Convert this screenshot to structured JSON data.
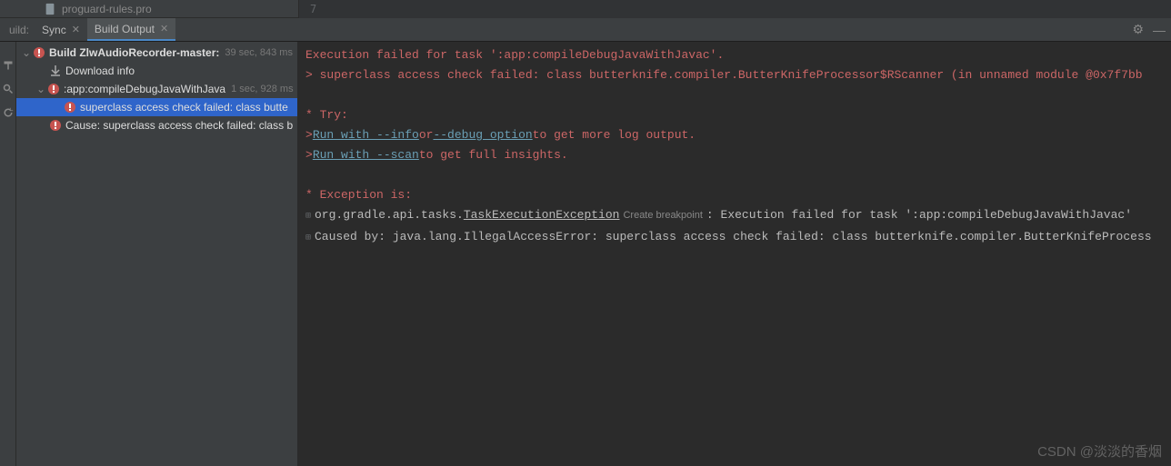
{
  "top_file": "proguard-rules.pro",
  "line_num": "7",
  "tabs": {
    "label": "uild:",
    "sync": "Sync",
    "build_output": "Build Output"
  },
  "tree": {
    "root": {
      "label": "Build ZlwAudioRecorder-master:",
      "time": "39 sec, 843 ms"
    },
    "download": "Download info",
    "task": {
      "label": ":app:compileDebugJavaWithJava",
      "time": "1 sec, 928 ms"
    },
    "superclass": "superclass access check failed: class butte",
    "cause": "Cause: superclass access check failed: class b"
  },
  "console": {
    "l1": "Execution failed for task ':app:compileDebugJavaWithJavac'.",
    "l2": "> superclass access check failed: class butterknife.compiler.ButterKnifeProcessor$RScanner (in unnamed module @0x7f7bb",
    "l3": "* Try:",
    "l4_a": "> ",
    "l4_link1": "Run with --info",
    "l4_b": " or ",
    "l4_link2": "--debug option",
    "l4_c": " to get more log output.",
    "l5_a": "> ",
    "l5_link": "Run with --scan",
    "l5_b": " to get full insights.",
    "l6": "* Exception is:",
    "l7_a": "org.gradle.api.tasks.",
    "l7_link": "TaskExecutionException",
    "l7_badge": "Create breakpoint",
    "l7_b": ": Execution failed for task ':app:compileDebugJavaWithJavac'",
    "l8": "Caused by: java.lang.IllegalAccessError: superclass access check failed: class butterknife.compiler.ButterKnifeProcess"
  },
  "watermark": "CSDN @淡淡的香烟"
}
